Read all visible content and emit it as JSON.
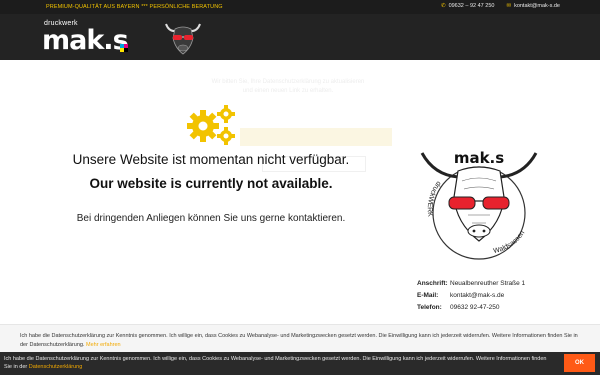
{
  "topbar": {
    "tagline": "PREMIUM-QUALITÄT AUS BAYERN *** PERSÖNLICHE BERATUNG",
    "phone": "09632 – 92 47 250",
    "email": "kontakt@mak-s.de",
    "phone_icon": "phone-icon",
    "mail_icon": "envelope-icon"
  },
  "logo": {
    "small_text": "druckwerk",
    "main_text": "mak.s"
  },
  "main": {
    "message_de": "Unsere Website ist momentan nicht verfügbar.",
    "message_en": "Our website is currently not available.",
    "message_sub": "Bei dringenden Anliegen können Sie uns gerne kontaktieren.",
    "ghost_text": "Wir bitten Sie, Ihre Datenschutzerklärung zu aktualisieren und einen neuen Link zu erhalten."
  },
  "badge": {
    "brand": "mak.s",
    "ring_left": "druckWERK",
    "ring_right": "Waldsassen"
  },
  "contact": {
    "address_label": "Anschrift:",
    "address_value": "Neualbenreuther Straße 1",
    "email_label": "E-Mail:",
    "email_value": "kontakt@mak-s.de",
    "phone_label": "Telefon:",
    "phone_value": "09632 92-47-250"
  },
  "cookie_banner_light": {
    "text": "Ich habe die Datenschutzerklärung zur Kenntnis genommen. Ich willige ein, dass Cookies zu Webanalyse- und Marketingzwecken gesetzt werden. Die Einwilligung kann ich jederzeit widerrufen. Weitere Informationen finden Sie in der Datenschutzerklärung.",
    "more_link": "Mehr erfahren"
  },
  "cookie_banner_dark": {
    "text": "Ich habe die Datenschutzerklärung zur Kenntnis genommen. Ich willige ein, dass Cookies zu Webanalyse- und Marketingzwecken gesetzt werden. Die Einwilligung kann ich jederzeit widerrufen. Weitere Informationen finden Sie in der",
    "link": "Datenschutzerklärung",
    "ok_label": "OK"
  },
  "colors": {
    "accent_yellow": "#f2c300",
    "header_dark": "#232323",
    "ok_orange": "#ff5a16"
  }
}
